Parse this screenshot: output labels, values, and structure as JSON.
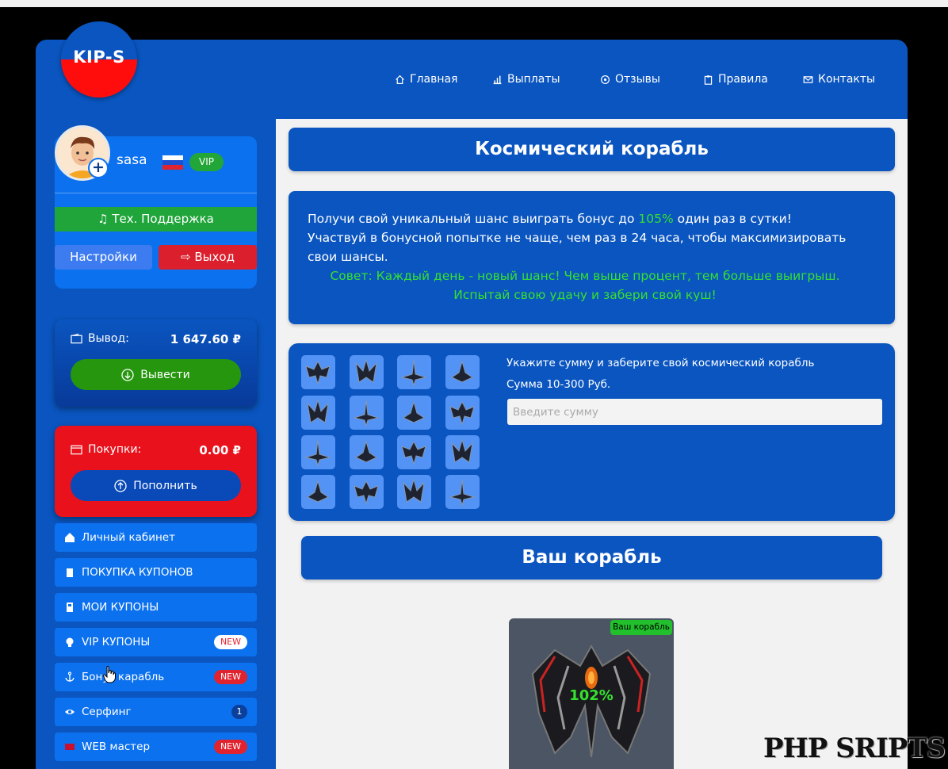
{
  "logo": {
    "text": "KIP-S"
  },
  "nav": [
    {
      "label": "Главная",
      "icon": "home-icon"
    },
    {
      "label": "Выплаты",
      "icon": "bar-chart-icon"
    },
    {
      "label": "Отзывы",
      "icon": "comment-icon"
    },
    {
      "label": "Правила",
      "icon": "clipboard-icon"
    },
    {
      "label": "Контакты",
      "icon": "envelope-icon"
    }
  ],
  "profile": {
    "username": "sasa",
    "vip_badge": "VIP",
    "support_button": "Тех. Поддержка",
    "settings_button": "Настройки",
    "logout_button": "Выход"
  },
  "withdraw": {
    "label": "Вывод:",
    "value": "1 647.60 ₽",
    "button": "Вывести"
  },
  "purchases": {
    "label": "Покупки:",
    "value": "0.00 ₽",
    "button": "Пополнить"
  },
  "menu": [
    {
      "label": "Личный кабинет",
      "icon": "home-icon",
      "badge": ""
    },
    {
      "label": "ПОКУПКА КУПОНОВ",
      "icon": "clipboard-icon",
      "badge": ""
    },
    {
      "label": "МОИ КУПОНЫ",
      "icon": "sd-card-icon",
      "badge": ""
    },
    {
      "label": "VIP КУПОНЫ",
      "icon": "lightbulb-icon",
      "badge": "NEW"
    },
    {
      "label": "Бонус карабль",
      "icon": "anchor-icon",
      "badge": "NEW"
    },
    {
      "label": "Серфинг",
      "icon": "eye-icon",
      "badge": "1"
    },
    {
      "label": "WEB мастер",
      "icon": "monitor-icon",
      "badge": "NEW"
    }
  ],
  "page": {
    "title": "Космический корабль",
    "info_line1_before": "Получи свой уникальный шанс выиграть бонус до ",
    "info_percent": "105%",
    "info_line1_after": " один раз в сутки!",
    "info_line2": "Участвуй в бонусной попытке не чаще, чем раз в 24 часа, чтобы максимизировать свои шансы.",
    "tip": "Совет: Каждый день - новый шанс! Чем выше процент, тем больше выигрыш. Испытай свою удачу и забери свой куш!",
    "form_title": "Укажите сумму и заберите свой космический корабль",
    "form_range": "Сумма 10-300 Руб.",
    "amount_placeholder": "Введите сумму",
    "your_ship_title": "Ваш корабль",
    "ship_badge": "Ваш корабль",
    "ship_percent": "102%"
  },
  "watermark": "PHP SRIPTS",
  "colors": {
    "brand_blue": "#0a55c0",
    "accent_red": "#e8111c",
    "success_green": "#1fa53a",
    "highlight_green": "#35e12e"
  }
}
